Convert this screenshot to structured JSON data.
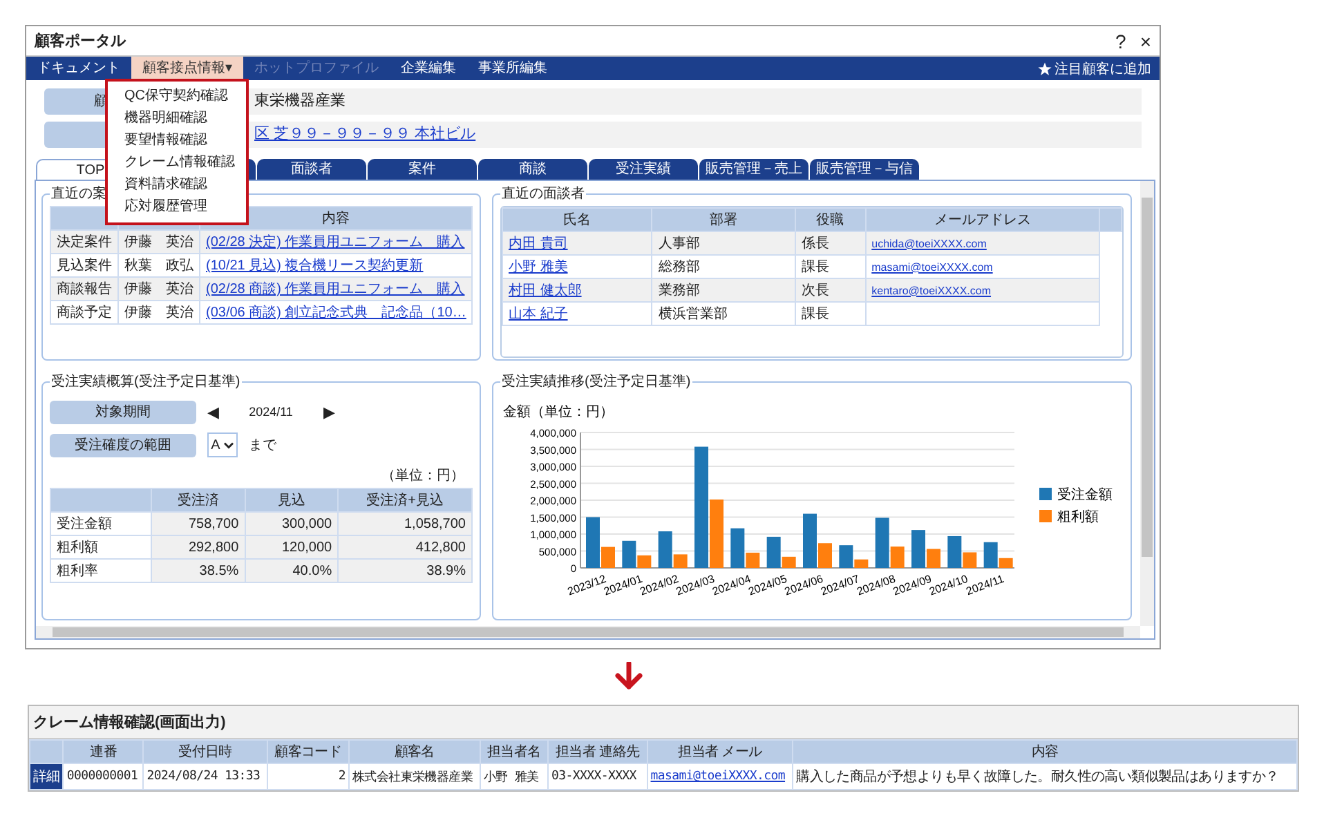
{
  "window": {
    "title": "顧客ポータル",
    "help": "?",
    "close": "×"
  },
  "nav": {
    "items": [
      {
        "label": "ドキュメント",
        "selected": false,
        "disabled": false
      },
      {
        "label": "顧客接点情報▾",
        "selected": true,
        "disabled": false
      },
      {
        "label": "ホットプロファイル",
        "selected": false,
        "disabled": true
      },
      {
        "label": "企業編集",
        "selected": false,
        "disabled": false
      },
      {
        "label": "事業所編集",
        "selected": false,
        "disabled": false
      }
    ],
    "favorite": "注目顧客に追加"
  },
  "menu": {
    "items": [
      "QC保守契約確認",
      "機器明細確認",
      "要望情報確認",
      "クレーム情報確認",
      "資料請求確認",
      "応対履歴管理"
    ]
  },
  "info": [
    {
      "label": "顧",
      "value": "東栄機器産業",
      "kind": "text"
    },
    {
      "value": "区 芝９９－９９－９９ 本社ビル",
      "kind": "link"
    }
  ],
  "tabs": [
    {
      "label": "TOP",
      "selected": true
    },
    {
      "selected": false
    },
    {
      "label": "面談者",
      "selected": false
    },
    {
      "label": "案件",
      "selected": false
    },
    {
      "label": "商談",
      "selected": false
    },
    {
      "label": "受注実績",
      "selected": false
    },
    {
      "label": "販売管理－売上",
      "selected": false
    },
    {
      "label": "販売管理－与信",
      "selected": false
    }
  ],
  "recent_deals": {
    "legend": "直近の案",
    "columns": {
      "column_3": "内容"
    },
    "rows": [
      {
        "type": "決定案件",
        "person": "伊藤　英治",
        "content": "(02/28 決定) 作業員用ユニフォーム　購入"
      },
      {
        "type": "見込案件",
        "person": "秋葉　政弘",
        "content": "(10/21 見込) 複合機リース契約更新"
      },
      {
        "type": "商談報告",
        "person": "伊藤　英治",
        "content": "(02/28 商談) 作業員用ユニフォーム　購入"
      },
      {
        "type": "商談予定",
        "person": "伊藤　英治",
        "content": "(03/06 商談) 創立記念式典　記念品（10…"
      }
    ]
  },
  "recent_contacts": {
    "legend": "直近の面談者",
    "columns": [
      "氏名",
      "部署",
      "役職",
      "メールアドレス"
    ],
    "rows": [
      {
        "name": "内田 貴司",
        "department": "人事部",
        "title": "係長",
        "email": "uchida@toeiXXXX.com"
      },
      {
        "name": "小野 雅美",
        "department": "総務部",
        "title": "課長",
        "email": "masami@toeiXXXX.com"
      },
      {
        "name": "村田 健太郎",
        "department": "業務部",
        "title": "次長",
        "email": "kentaro@toeiXXXX.com"
      },
      {
        "name": "山本 紀子",
        "department": "横浜営業部",
        "title": "課長"
      }
    ]
  },
  "estimate": {
    "legend": "受注実績概算(受注予定日基準)",
    "period_button": "対象期間",
    "prev": "◀",
    "period": "2024/11",
    "next": "▶",
    "range_button": "受注確度の範囲",
    "range_value": "A",
    "range_suffix": "まで",
    "unit": "（単位：円）",
    "columns": [
      "受注済",
      "見込",
      "受注済+見込"
    ],
    "rows": [
      {
        "label": "受注金額",
        "values": [
          "758,700",
          "300,000",
          "1,058,700"
        ]
      },
      {
        "label": "粗利額",
        "values": [
          "292,800",
          "120,000",
          "412,800"
        ]
      },
      {
        "label": "粗利率",
        "values": [
          "38.5%",
          "40.0%",
          "38.9%"
        ]
      }
    ]
  },
  "trend": {
    "legend": "受注実績推移(受注予定日基準)",
    "chart_data": {
      "type": "bar",
      "ylabel": "金額（単位：円）",
      "categories": [
        "2023/12",
        "2024/01",
        "2024/02",
        "2024/03",
        "2024/04",
        "2024/05",
        "2024/06",
        "2024/07",
        "2024/08",
        "2024/09",
        "2024/10",
        "2024/11"
      ],
      "series": [
        {
          "name": "受注金額",
          "color": "#1f77b4",
          "values": [
            1500000,
            800000,
            1080000,
            3580000,
            1170000,
            920000,
            1600000,
            670000,
            1480000,
            1120000,
            940000,
            760000
          ]
        },
        {
          "name": "粗利額",
          "color": "#ff7f0e",
          "values": [
            620000,
            370000,
            400000,
            2020000,
            450000,
            330000,
            730000,
            250000,
            630000,
            560000,
            460000,
            290000
          ]
        }
      ],
      "ylim": [
        0,
        4000000
      ],
      "grid": true,
      "legend": true,
      "yticks": [
        0,
        {
          "value": 500000,
          "label": "500,000"
        },
        {
          "value": 1000000,
          "label": "1,000,000"
        },
        {
          "value": 1500000,
          "label": "1,500,000"
        },
        {
          "value": 2000000,
          "label": "2,000,000"
        },
        {
          "value": 2500000,
          "label": "2,500,000"
        },
        {
          "value": 3000000,
          "label": "3,000,000"
        },
        {
          "value": 3500000,
          "label": "3,500,000"
        },
        {
          "value": 4000000,
          "label": "4,000,000"
        }
      ]
    }
  },
  "claim": {
    "title": "クレーム情報確認(画面出力)",
    "columns": [
      {
        "label": "連番",
        "kind": "text"
      },
      {
        "label": "受付日時",
        "kind": "text"
      },
      {
        "label": "顧客コード",
        "kind": "number"
      },
      {
        "label": "顧客名",
        "kind": "text"
      },
      {
        "label": "担当者名",
        "kind": "text"
      },
      {
        "label": "担当者 連絡先",
        "kind": "text"
      },
      {
        "label": "担当者 メール",
        "kind": "link"
      },
      {
        "label": "内容",
        "kind": "text"
      }
    ],
    "rows": [
      {
        "detail": "詳細",
        "cells": [
          "0000000001",
          "2024/08/24 13:33",
          "2",
          "株式会社東栄機器産業",
          "小野 雅美",
          "03-XXXX-XXXX",
          "masami@toeiXXXX.com",
          "購入した商品が予想よりも早く故障した。耐久性の高い類似製品はありますか？"
        ]
      }
    ]
  }
}
